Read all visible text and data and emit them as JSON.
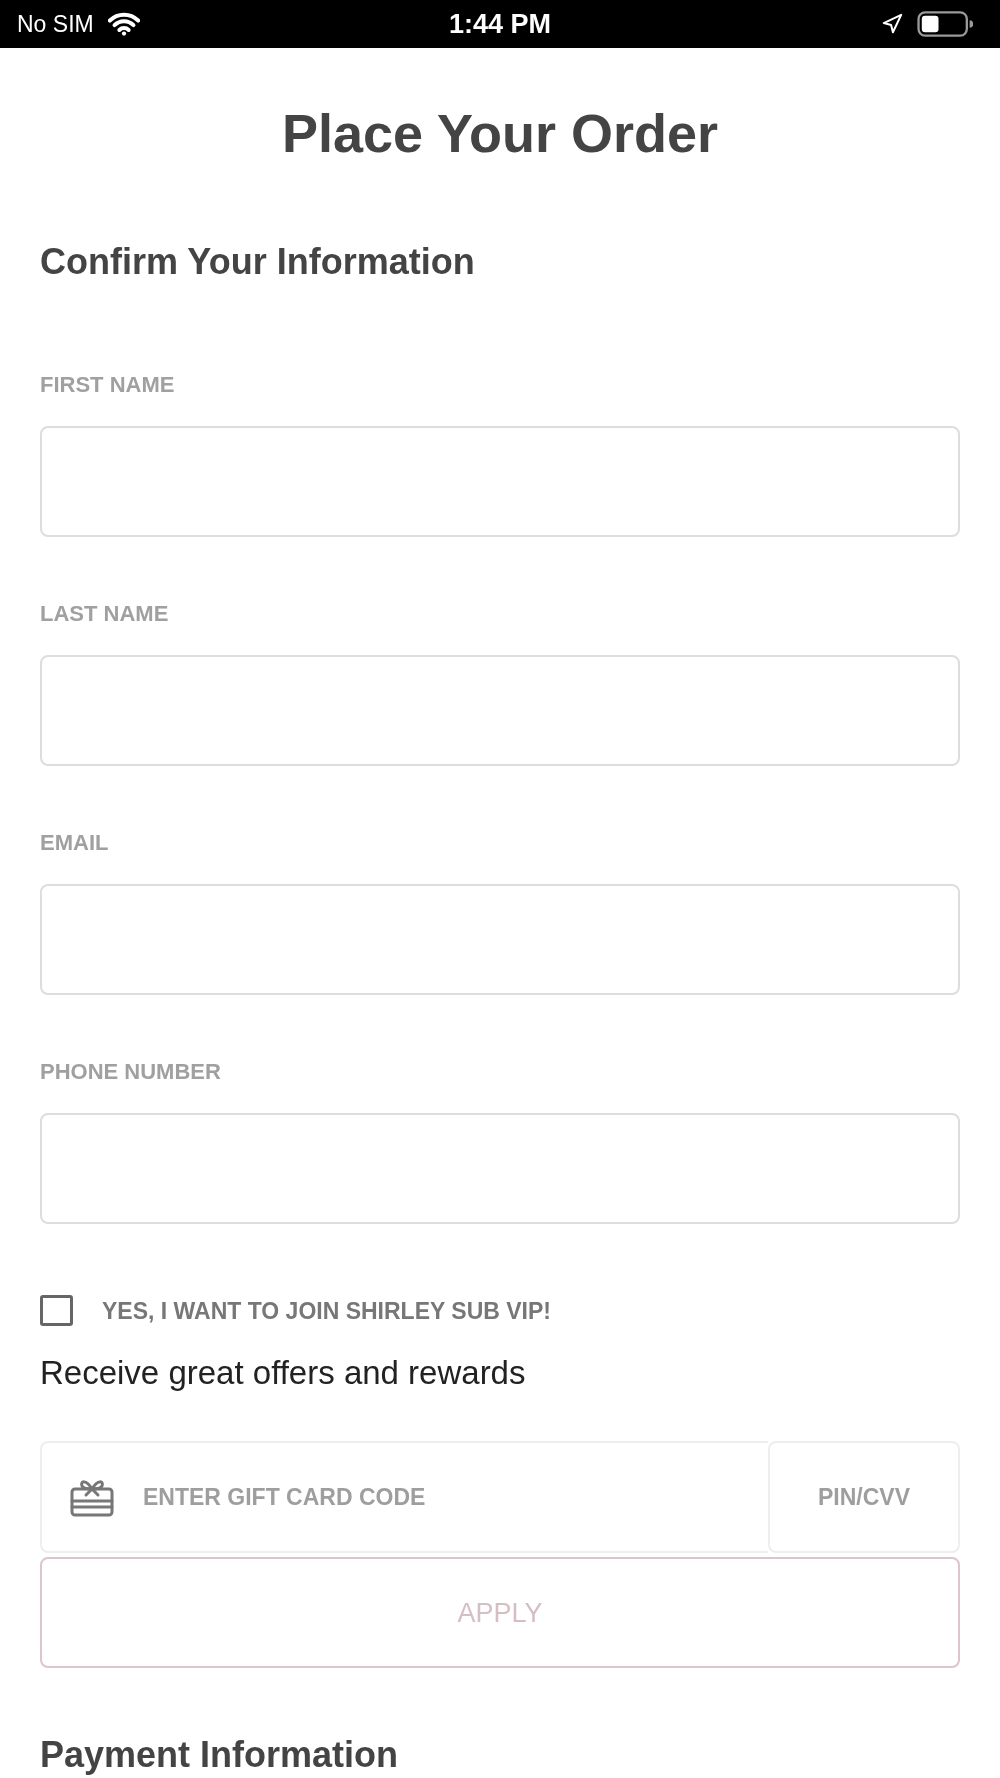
{
  "status_bar": {
    "carrier": "No SIM",
    "time": "1:44 PM"
  },
  "page_title": "Place Your Order",
  "contact_section": {
    "heading": "Confirm Your Information",
    "fields": [
      {
        "label": "FIRST NAME"
      },
      {
        "label": "LAST NAME"
      },
      {
        "label": "EMAIL"
      },
      {
        "label": "PHONE NUMBER"
      }
    ]
  },
  "vip_opt_in": {
    "label": "YES, I WANT TO JOIN SHIRLEY SUB VIP!",
    "checked": false,
    "description": "Receive great offers and rewards"
  },
  "gift_card": {
    "code_field": {
      "placeholder": "ENTER GIFT CARD CODE"
    },
    "pin_field": {
      "placeholder": "PIN/CVV"
    },
    "apply_button": {
      "label": "APPLY",
      "disabled": true
    }
  },
  "payment_section": {
    "heading": "Payment Information"
  }
}
